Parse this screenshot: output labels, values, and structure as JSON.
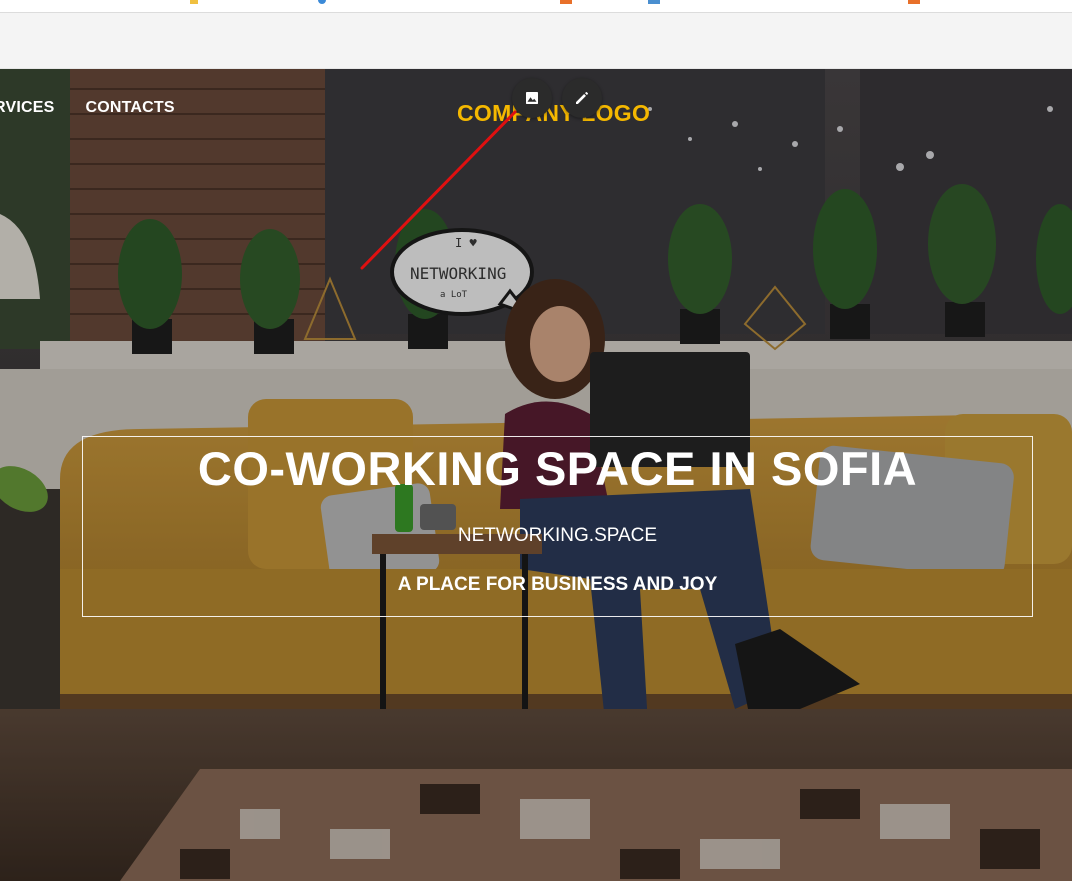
{
  "nav": {
    "items": [
      {
        "label": "RVICES"
      },
      {
        "label": "CONTACTS"
      }
    ]
  },
  "logo": {
    "text": "COMPANY LOGO"
  },
  "editor": {
    "image_icon": "image-icon",
    "edit_icon": "pencil-icon"
  },
  "hero": {
    "headline": "CO-WORKING SPACE IN SOFIA",
    "subtitle": "NETWORKING.SPACE",
    "tagline": "A PLACE FOR BUSINESS AND JOY",
    "background_sign": {
      "line1": "I ♥",
      "line2": "NETWORKING",
      "line3": "a LoT"
    }
  },
  "colors": {
    "logo": "#f5b800",
    "annotation_arrow": "#e01010",
    "sofa": "#c79a3a"
  }
}
